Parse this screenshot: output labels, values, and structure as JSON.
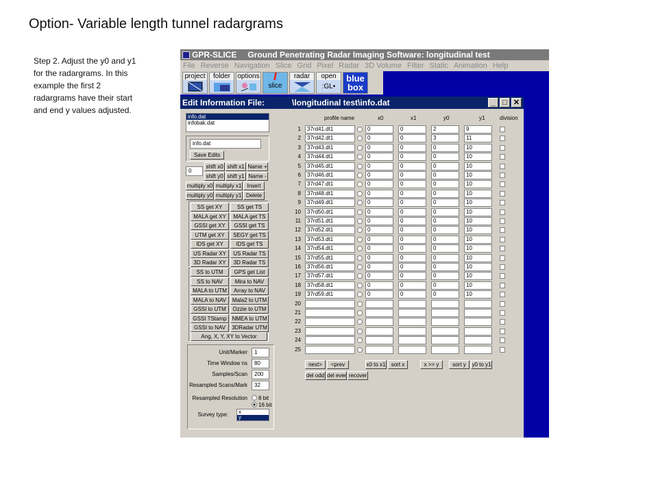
{
  "slide": {
    "title": "Option- Variable length tunnel radargrams",
    "step_text": "Step 2. Adjust the y0 and y1 for the radargrams.   In this example the first 2 radargrams have their start and end y values adjusted."
  },
  "app": {
    "name": "GPR-SLICE",
    "subtitle": "Ground Penetrating Radar Imaging Software:   longitudinal test",
    "menu": [
      "File",
      "Reverse",
      "Navigation",
      "Slice",
      "Grid",
      "Pixel",
      "Radar",
      "3D Volume",
      "Filter",
      "Static",
      "Animation",
      "Help"
    ],
    "toolbar": [
      {
        "label": "project",
        "icon": "project-icon"
      },
      {
        "label": "folder",
        "icon": "folder-icon"
      },
      {
        "label": "options",
        "icon": "options-icon"
      },
      {
        "label": "slice",
        "icon": "slice-icon"
      },
      {
        "label": "radar",
        "icon": "radar-icon"
      },
      {
        "label": "open",
        "sub": "GL",
        "icon": "open-gl-icon"
      },
      {
        "label": "blue box",
        "icon": "blue-box-icon"
      }
    ]
  },
  "dialog": {
    "title": "Edit Information File:",
    "path": "\\longitudinal test\\info.dat",
    "controls": [
      "_",
      "□",
      "✕"
    ],
    "files": [
      "info.dat",
      "infobak.dat"
    ],
    "filename_value": "info.dat",
    "save_label": "Save Edits",
    "shift_value": "0",
    "shift_buttons": [
      "shift x0",
      "shift x1",
      "Name +",
      "shift y0",
      "shift y1",
      "Name -",
      "multiply x0",
      "multiply x1",
      "Insert",
      "multiply y0",
      "multiply y1",
      "Delete"
    ],
    "get_buttons": [
      "SS get XY",
      "SS get TS",
      "MALA get XY",
      "MALA get TS",
      "GSSI get XY",
      "GSSI get TS",
      "UTM get XY",
      "SEGY get TS",
      "IDS get XY",
      "IDS get TS",
      "US Radar XY",
      "US Radar TS",
      "3D Radar XY",
      "3D Radar TS"
    ],
    "convert_buttons": [
      "SS to UTM",
      "GPS get List",
      "SS to NAV",
      "Mira to NAV",
      "MALA to UTM",
      "Array to NAV",
      "MALA to NAV",
      "Mala2 to UTM",
      "GSSI to UTM",
      "Ozzie to UTM",
      "GSSI TStamp",
      "NMEA to UTM",
      "GSSI to NAV",
      "3DRadar UTM"
    ],
    "angle_button": "Ang, X, Y, XY to Vector",
    "params": [
      {
        "label": "Unit/Marker",
        "value": "1"
      },
      {
        "label": "Time Window ns",
        "value": "80"
      },
      {
        "label": "Samples/Scan",
        "value": "200"
      },
      {
        "label": "Resampled Scans/Mark",
        "value": "32"
      }
    ],
    "resolution_label": "Resampled Resolution",
    "resolution_options": [
      "8 bit",
      "16 bit"
    ],
    "resolution_selected": "16 bit",
    "survey_label": "Survey type:",
    "survey_options": [
      "x",
      "y"
    ],
    "survey_selected": "y",
    "columns": [
      "profile name",
      "x0",
      "x1",
      "y0",
      "y1",
      "division"
    ],
    "rows": [
      {
        "n": "1",
        "name": "37rd41.dt1",
        "x0": "0",
        "x1": "0",
        "y0": "2",
        "y1": "9"
      },
      {
        "n": "2",
        "name": "37rd42.dt1",
        "x0": "0",
        "x1": "0",
        "y0": "3",
        "y1": "11"
      },
      {
        "n": "3",
        "name": "37rd43.dt1",
        "x0": "0",
        "x1": "0",
        "y0": "0",
        "y1": "10"
      },
      {
        "n": "4",
        "name": "37rd44.dt1",
        "x0": "0",
        "x1": "0",
        "y0": "0",
        "y1": "10"
      },
      {
        "n": "5",
        "name": "37rd45.dt1",
        "x0": "0",
        "x1": "0",
        "y0": "0",
        "y1": "10"
      },
      {
        "n": "6",
        "name": "37rd46.dt1",
        "x0": "0",
        "x1": "0",
        "y0": "0",
        "y1": "10"
      },
      {
        "n": "7",
        "name": "37rd47.dt1",
        "x0": "0",
        "x1": "0",
        "y0": "0",
        "y1": "10"
      },
      {
        "n": "8",
        "name": "37rd48.dt1",
        "x0": "0",
        "x1": "0",
        "y0": "0",
        "y1": "10"
      },
      {
        "n": "9",
        "name": "37rd49.dt1",
        "x0": "0",
        "x1": "0",
        "y0": "0",
        "y1": "10"
      },
      {
        "n": "10",
        "name": "37rd50.dt1",
        "x0": "0",
        "x1": "0",
        "y0": "0",
        "y1": "10"
      },
      {
        "n": "11",
        "name": "37rd51.dt1",
        "x0": "0",
        "x1": "0",
        "y0": "0",
        "y1": "10"
      },
      {
        "n": "12",
        "name": "37rd52.dt1",
        "x0": "0",
        "x1": "0",
        "y0": "0",
        "y1": "10"
      },
      {
        "n": "13",
        "name": "37rd53.dt1",
        "x0": "0",
        "x1": "0",
        "y0": "0",
        "y1": "10"
      },
      {
        "n": "14",
        "name": "37rd54.dt1",
        "x0": "0",
        "x1": "0",
        "y0": "0",
        "y1": "10"
      },
      {
        "n": "15",
        "name": "37rd55.dt1",
        "x0": "0",
        "x1": "0",
        "y0": "0",
        "y1": "10"
      },
      {
        "n": "16",
        "name": "37rd56.dt1",
        "x0": "0",
        "x1": "0",
        "y0": "0",
        "y1": "10"
      },
      {
        "n": "17",
        "name": "37rd57.dt1",
        "x0": "0",
        "x1": "0",
        "y0": "0",
        "y1": "10"
      },
      {
        "n": "18",
        "name": "37rd58.dt1",
        "x0": "0",
        "x1": "0",
        "y0": "0",
        "y1": "10"
      },
      {
        "n": "19",
        "name": "37rd59.dt1",
        "x0": "0",
        "x1": "0",
        "y0": "0",
        "y1": "10"
      },
      {
        "n": "20",
        "name": "",
        "x0": "",
        "x1": "",
        "y0": "",
        "y1": ""
      },
      {
        "n": "21",
        "name": "",
        "x0": "",
        "x1": "",
        "y0": "",
        "y1": ""
      },
      {
        "n": "22",
        "name": "",
        "x0": "",
        "x1": "",
        "y0": "",
        "y1": ""
      },
      {
        "n": "23",
        "name": "",
        "x0": "",
        "x1": "",
        "y0": "",
        "y1": ""
      },
      {
        "n": "24",
        "name": "",
        "x0": "",
        "x1": "",
        "y0": "",
        "y1": ""
      },
      {
        "n": "25",
        "name": "",
        "x0": "",
        "x1": "",
        "y0": "",
        "y1": ""
      }
    ],
    "nav_buttons": [
      "next>",
      "<prev",
      "x0 to x1",
      "sort x",
      "x >> y",
      "sort y",
      "y0 to y1"
    ],
    "bottom_buttons": [
      "del odd",
      "del even",
      "recover"
    ]
  }
}
